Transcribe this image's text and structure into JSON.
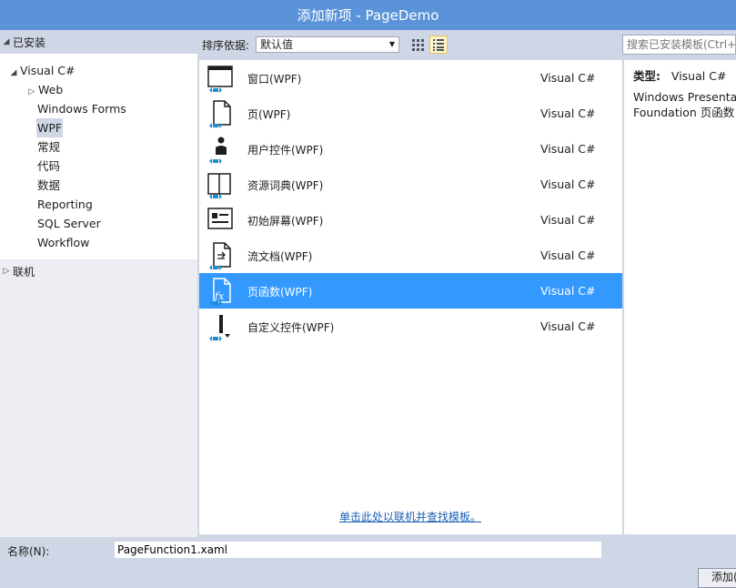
{
  "window": {
    "title": "添加新项 - PageDemo"
  },
  "left_panel": {
    "installed_label": "已安装",
    "online_label": "联机",
    "tree": [
      {
        "label": "Visual C#",
        "expander": "◢",
        "indent": 0
      },
      {
        "label": "Web",
        "expander": "▷",
        "indent": 1
      },
      {
        "label": "Windows Forms",
        "expander": "",
        "indent": 1
      },
      {
        "label": "WPF",
        "expander": "",
        "indent": 1,
        "selected": true
      },
      {
        "label": "常规",
        "expander": "",
        "indent": 1
      },
      {
        "label": "代码",
        "expander": "",
        "indent": 1
      },
      {
        "label": "数据",
        "expander": "",
        "indent": 1
      },
      {
        "label": "Reporting",
        "expander": "",
        "indent": 1
      },
      {
        "label": "SQL Server",
        "expander": "",
        "indent": 1
      },
      {
        "label": "Workflow",
        "expander": "",
        "indent": 1
      }
    ]
  },
  "toolbar": {
    "sort_label": "排序依据:",
    "sort_value": "默认值",
    "search_placeholder": "搜索已安装模板(Ctrl+E)"
  },
  "templates": [
    {
      "name": "窗口(WPF)",
      "lang": "Visual C#",
      "icon": "window-icon"
    },
    {
      "name": "页(WPF)",
      "lang": "Visual C#",
      "icon": "page-icon"
    },
    {
      "name": "用户控件(WPF)",
      "lang": "Visual C#",
      "icon": "user-control-icon"
    },
    {
      "name": "资源词典(WPF)",
      "lang": "Visual C#",
      "icon": "resource-dictionary-icon"
    },
    {
      "name": "初始屏幕(WPF)",
      "lang": "Visual C#",
      "icon": "splash-screen-icon"
    },
    {
      "name": "流文档(WPF)",
      "lang": "Visual C#",
      "icon": "flow-document-icon"
    },
    {
      "name": "页函数(WPF)",
      "lang": "Visual C#",
      "icon": "page-function-icon",
      "selected": true
    },
    {
      "name": "自定义控件(WPF)",
      "lang": "Visual C#",
      "icon": "custom-control-icon"
    }
  ],
  "online_link": "单击此处以联机并查找模板。",
  "details": {
    "type_label": "类型:",
    "type_value": "Visual C#",
    "description": "Windows Presentation Foundation 页函数"
  },
  "bottom": {
    "name_label": "名称(N):",
    "name_value": "PageFunction1.xaml",
    "add_label": "添加(A)"
  },
  "colors": {
    "title_bar": "#5b93d8",
    "selection": "#3399ff",
    "chrome": "#cfd6e5",
    "badge": "#1a8fd0"
  }
}
